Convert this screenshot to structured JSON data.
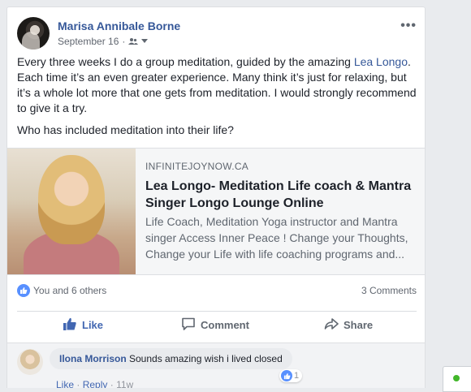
{
  "post": {
    "author": "Marisa Annibale Borne",
    "date": "September 16",
    "privacy_icon": "friends-icon",
    "more_label": "•••",
    "paragraph_1_a": "Every three weeks I do a group meditation, guided by the amazing ",
    "mention": "Lea Longo",
    "paragraph_1_b": ". Each time it’s an even greater experience. Many think it’s just for relaxing, but it’s a whole lot more that one gets from meditation. I would strongly recommend to give it a try.",
    "paragraph_2": "Who has included meditation into their life?"
  },
  "link_preview": {
    "domain": "INFINITEJOYNOW.CA",
    "title": "Lea Longo- Meditation Life coach & Mantra Singer Longo Lounge Online",
    "description": "Life Coach, Meditation Yoga instructor and Mantra singer Access Inner Peace ! Change your Thoughts, Change your Life with life coaching programs and..."
  },
  "stats": {
    "likes_text": "You and 6 others",
    "comments_text": "3 Comments"
  },
  "actions": {
    "like": "Like",
    "comment": "Comment",
    "share": "Share"
  },
  "comment": {
    "author": "Ilona Morrison",
    "text": " Sounds amazing wish i lived closed",
    "reaction_count": "1",
    "like": "Like",
    "reply": "Reply",
    "time": "11w"
  },
  "colors": {
    "link_blue": "#365899",
    "like_blue": "#4267b2",
    "online_green": "#42b72a"
  }
}
